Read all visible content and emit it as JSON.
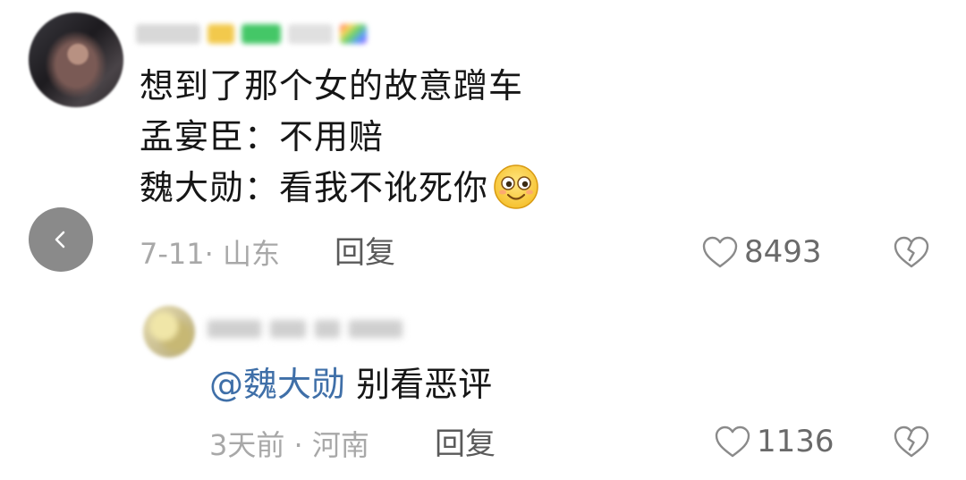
{
  "comment": {
    "lines": [
      "想到了那个女的故意蹭车",
      "孟宴臣：不用赔",
      "魏大勋：看我不讹死你"
    ],
    "date": "7-11",
    "location": "山东",
    "reply_label": "回复",
    "likes": "8493"
  },
  "reply": {
    "mention": "@魏大勋",
    "text": " 别看恶评",
    "date": "3天前",
    "location": "河南",
    "reply_label": "回复",
    "likes": "1136"
  },
  "icons": {
    "back": "chevron-left-icon",
    "like": "heart-outline-icon",
    "dislike": "broken-heart-icon",
    "emoji": "smiling-face-emoji"
  },
  "colors": {
    "text": "#161616",
    "meta": "#a8a8a8",
    "mention": "#3f6fa8",
    "back_button": "#8a8a8a"
  }
}
